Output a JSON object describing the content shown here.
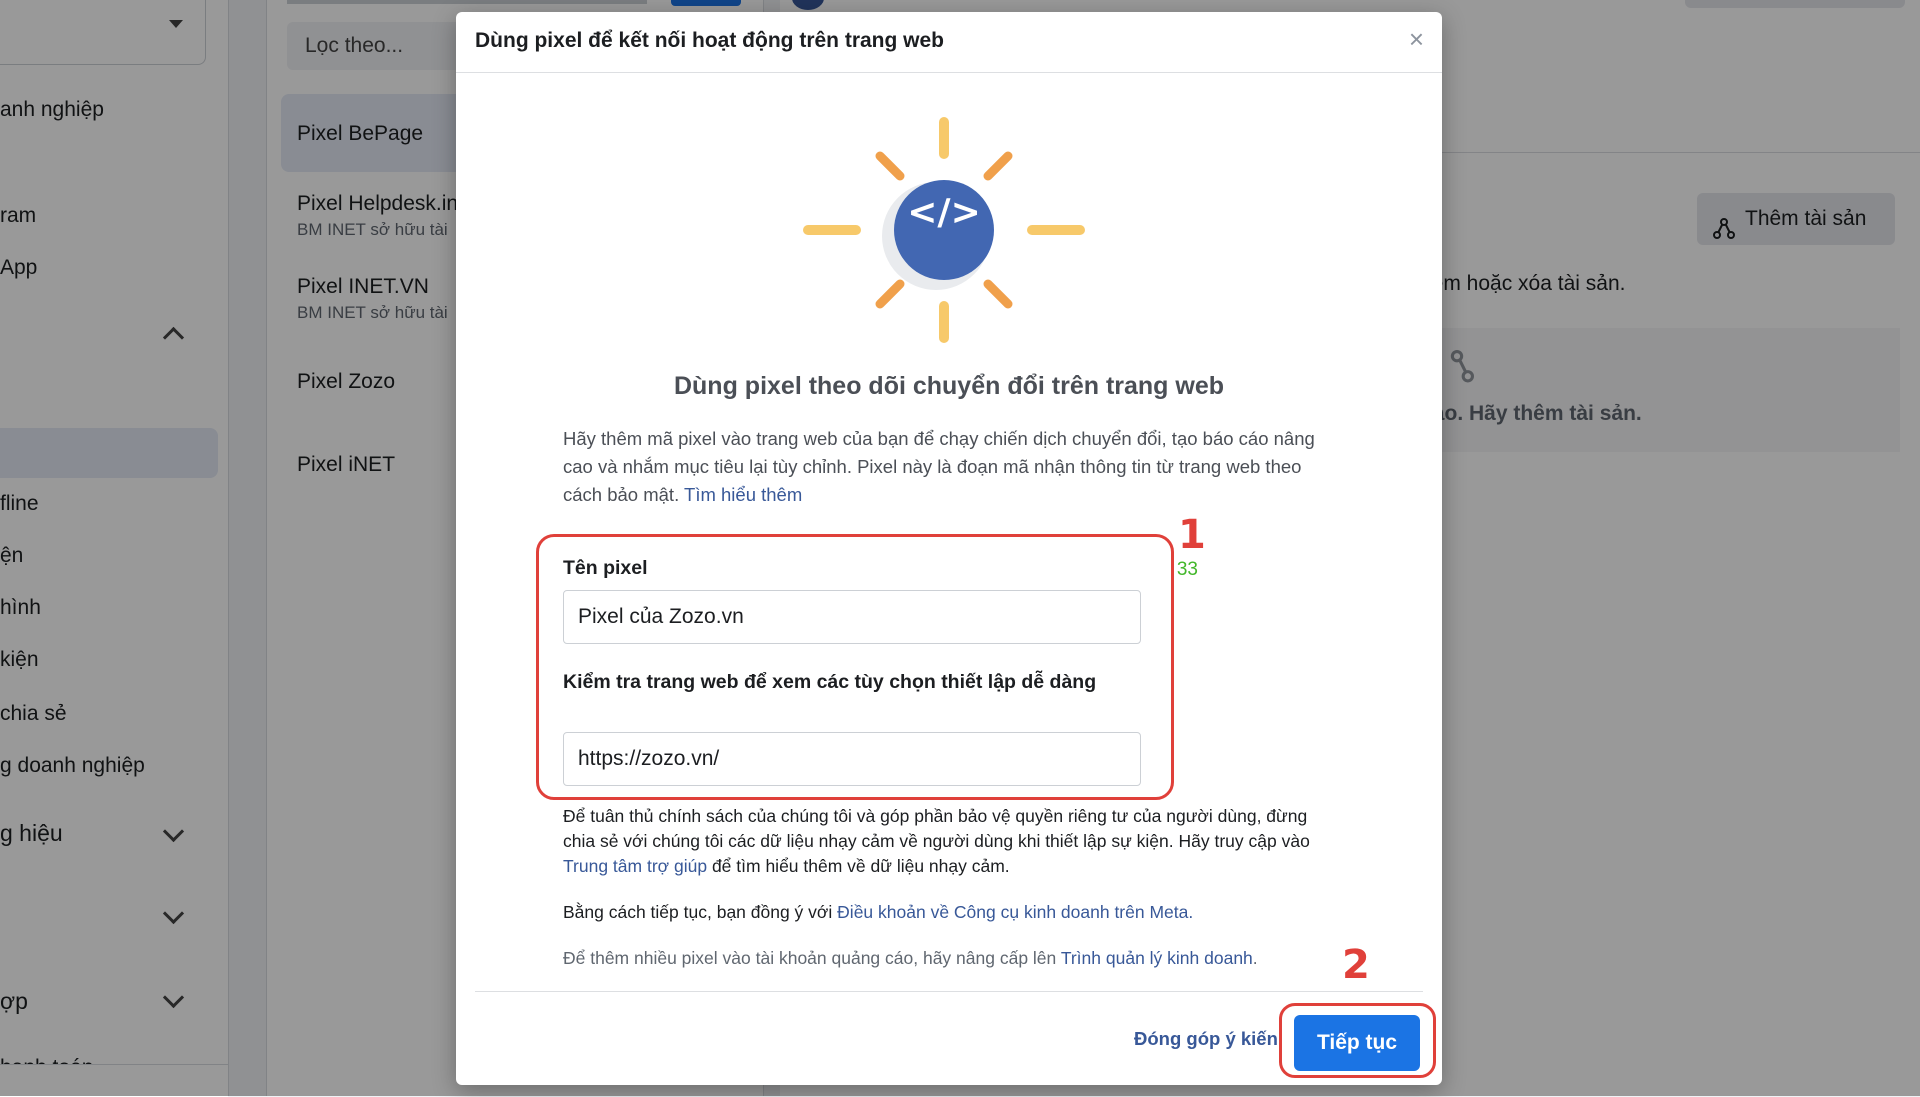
{
  "sidebar": {
    "items": [
      {
        "label": "anh nghiệp"
      },
      {
        "label": "ram"
      },
      {
        "label": "App"
      },
      {
        "label": "fline"
      },
      {
        "label": "ện"
      },
      {
        "label": "hình"
      },
      {
        "label": "kiện"
      },
      {
        "label": "chia sẻ"
      },
      {
        "label": "g doanh nghiệp"
      },
      {
        "label": "g hiệu"
      },
      {
        "label": "ợp"
      },
      {
        "label": "hanh toán"
      }
    ]
  },
  "pixel_list": {
    "filter_placeholder": "Lọc theo...",
    "items": [
      {
        "name": "Pixel BePage",
        "sub": ""
      },
      {
        "name": "Pixel Helpdesk.in",
        "sub": "BM INET sở hữu tài"
      },
      {
        "name": "Pixel INET.VN",
        "sub": "BM INET sở hữu tài"
      },
      {
        "name": "Pixel Zozo",
        "sub": ""
      },
      {
        "name": "Pixel iNET",
        "sub": ""
      }
    ]
  },
  "right_panel": {
    "add_asset_label": "Thêm tài sản",
    "text_manage": "hêm hoặc xóa tài sản.",
    "empty_text": "nào. Hãy thêm tài sản."
  },
  "modal": {
    "title": "Dùng pixel để kết nối hoạt động trên trang web",
    "close_label": "×",
    "heading": "Dùng pixel theo dõi chuyển đổi trên trang web",
    "description": "Hãy thêm mã pixel vào trang web của bạn để chạy chiến dịch chuyển đổi, tạo báo cáo nâng cao và nhắm mục tiêu lại tùy chỉnh. Pixel này là đoạn mã nhận thông tin từ trang web theo cách bảo mật.",
    "learn_more": "Tìm hiểu thêm",
    "pixel_name_label": "Tên pixel",
    "pixel_name_counter": "33",
    "pixel_name_value": "Pixel của Zozo.vn",
    "website_label": "Kiểm tra trang web để xem các tùy chọn thiết lập dễ dàng",
    "website_value": "https://zozo.vn/",
    "privacy_text_1": "Để tuân thủ chính sách của chúng tôi và góp phần bảo vệ quyền riêng tư của người dùng, đừng chia sẻ với chúng tôi các dữ liệu nhạy cảm về người dùng khi thiết lập sự kiện. Hãy truy cập vào",
    "privacy_link": "Trung tâm trợ giúp",
    "privacy_text_2": "để tìm hiểu thêm về dữ liệu nhạy cảm.",
    "terms_text": "Bằng cách tiếp tục, bạn đồng ý với",
    "terms_link": "Điều khoản về Công cụ kinh doanh trên Meta",
    "terms_end": ".",
    "upgrade_text": "Để thêm nhiều pixel vào tài khoản quảng cáo, hãy nâng cấp lên",
    "upgrade_link": "Trình quản lý kinh doanh",
    "upgrade_end": ".",
    "feedback_label": "Đóng góp ý kiến",
    "continue_label": "Tiếp tục",
    "code_icon_text": "</>"
  },
  "annotations": {
    "step1": "1",
    "step2": "2"
  },
  "colors": {
    "accent": "#1b74e4",
    "link": "#385898",
    "annotation": "#e0403a",
    "counter": "#42b72a",
    "sun_ray": "#f7c96a",
    "sun_ray_orange": "#f0a04b",
    "code_circle": "#4267b2"
  }
}
